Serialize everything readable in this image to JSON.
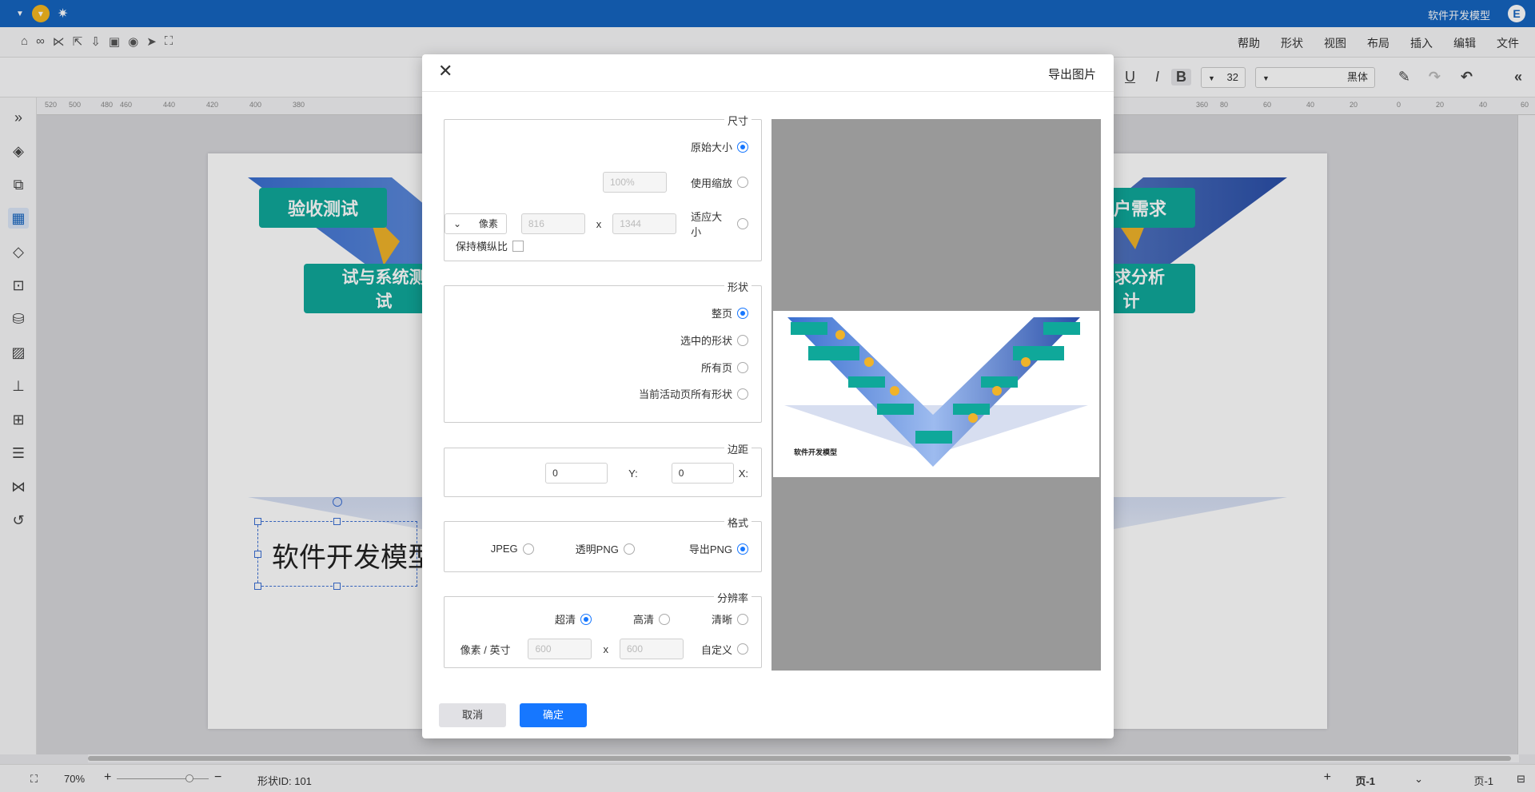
{
  "titlebar": {
    "doc_title": "软件开发模型",
    "logo": "E",
    "vip_icon": "gem-icon",
    "sun_icon": "sun-icon"
  },
  "menu": {
    "items": [
      "文件",
      "编辑",
      "插入",
      "布局",
      "视图",
      "形状",
      "帮助"
    ]
  },
  "toolbar": {
    "font_family": "黑体",
    "font_size": "32",
    "bold": "B",
    "italic": "I",
    "underline": "U"
  },
  "ruler": {
    "h_ticks": [
      "60",
      "40",
      "20",
      "0",
      "20",
      "40",
      "60",
      "80",
      "360",
      "380",
      "400",
      "420",
      "440",
      "460",
      "480",
      "500",
      "520"
    ]
  },
  "canvas": {
    "shapes": {
      "top_right": "用户需求",
      "top_left": "验收测试",
      "mid_right": "需求分析\n计",
      "mid_left": "试与系统测\n试"
    },
    "text": "软件开发模型"
  },
  "statusbar": {
    "page_name": "页-1",
    "page_tab": "页-1",
    "shape_id": "形状ID: 101",
    "zoom": "70%"
  },
  "dialog": {
    "title": "导出图片",
    "size": {
      "legend": "尺寸",
      "original": "原始大小",
      "zoom": "使用缩放",
      "zoom_value": "100%",
      "fit": "适应大小",
      "width": "1344",
      "height": "816",
      "times": "x",
      "unit": "像素",
      "keep_ratio": "保持横纵比"
    },
    "shape": {
      "legend": "形状",
      "whole_page": "整页",
      "selected": "选中的形状",
      "all_pages": "所有页",
      "current_page_all": "当前活动页所有形状"
    },
    "margin": {
      "legend": "边距",
      "x_label": "X:",
      "x_value": "0",
      "y_label": "Y:",
      "y_value": "0"
    },
    "format": {
      "legend": "格式",
      "png": "导出PNG",
      "transparent_png": "透明PNG",
      "jpeg": "JPEG"
    },
    "resolution": {
      "legend": "分辨率",
      "clear": "清晰",
      "high": "高清",
      "ultra": "超清",
      "custom": "自定义",
      "w": "600",
      "h": "600",
      "times": "x",
      "unit": "像素 / 英寸"
    },
    "preview_caption": "软件开发模型",
    "confirm": "确定",
    "cancel": "取消"
  },
  "colors": {
    "accent": "#1677ff",
    "titlebar": "#1565c0",
    "teal": "#0fa89a"
  }
}
